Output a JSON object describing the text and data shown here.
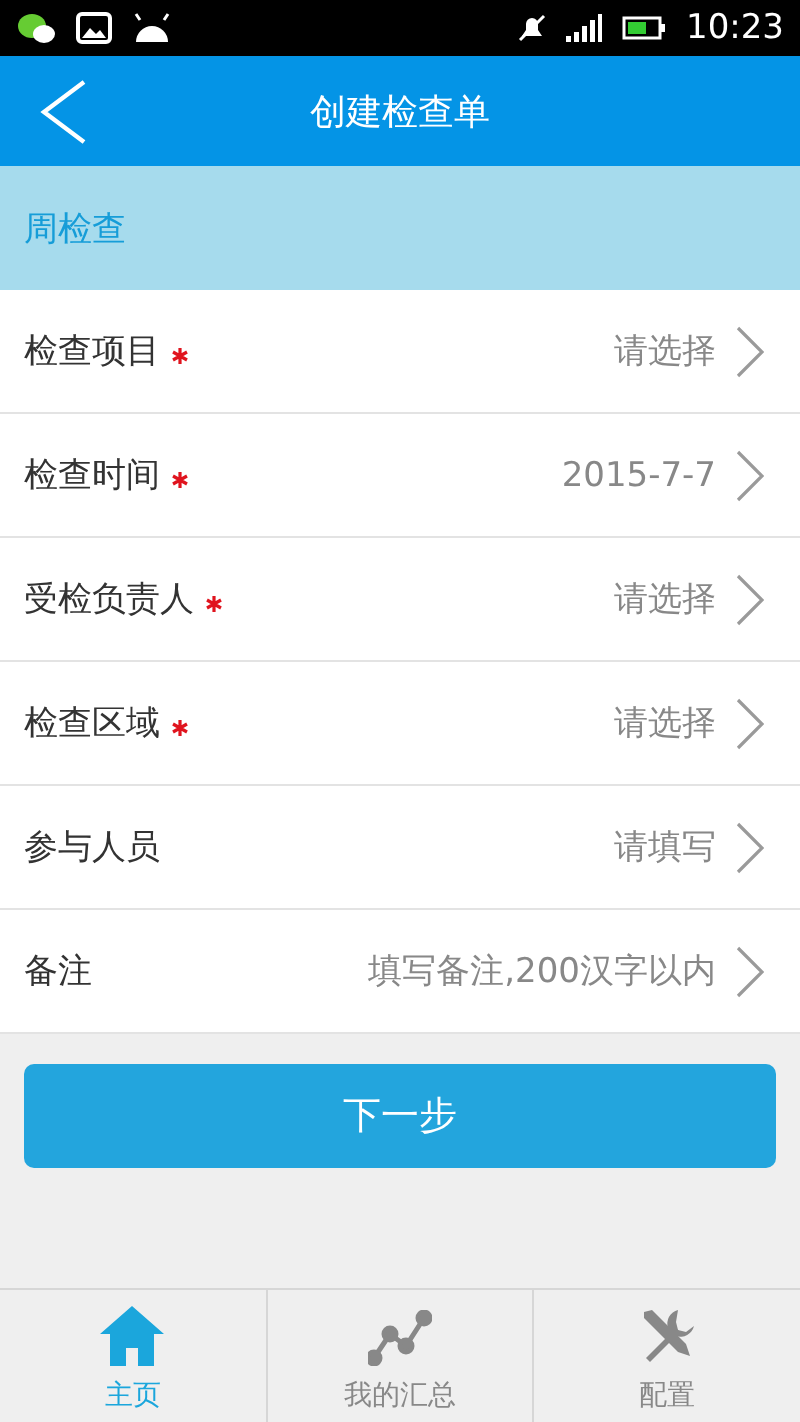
{
  "status_bar": {
    "time": "10:23"
  },
  "header": {
    "title": "创建检查单"
  },
  "section": {
    "title": "周检查"
  },
  "rows": [
    {
      "label": "检查项目",
      "required": true,
      "value": "请选择"
    },
    {
      "label": "检查时间",
      "required": true,
      "value": "2015-7-7"
    },
    {
      "label": "受检负责人",
      "required": true,
      "value": "请选择"
    },
    {
      "label": "检查区域",
      "required": true,
      "value": "请选择"
    },
    {
      "label": "参与人员",
      "required": false,
      "value": "请填写"
    },
    {
      "label": "备注",
      "required": false,
      "value": "填写备注,200汉字以内"
    }
  ],
  "next_button": "下一步",
  "tabs": [
    {
      "kind": "home",
      "label": "主页",
      "selected": true
    },
    {
      "kind": "chart",
      "label": "我的汇总",
      "selected": false
    },
    {
      "kind": "tools",
      "label": "配置",
      "selected": false
    }
  ]
}
